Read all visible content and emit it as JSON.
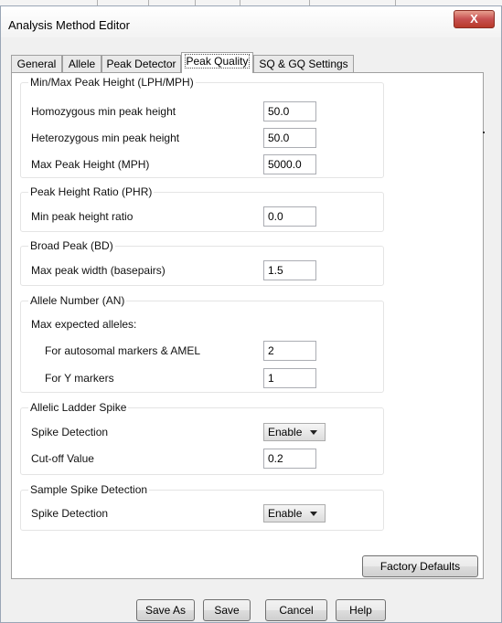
{
  "window": {
    "title": "Analysis Method Editor",
    "close_glyph": "X"
  },
  "tabs": [
    "General",
    "Allele",
    "Peak Detector",
    "Peak Quality",
    "SQ & GQ Settings"
  ],
  "active_tab": "Peak Quality",
  "groups": {
    "lph": {
      "title": "Min/Max Peak Height (LPH/MPH)",
      "homozygous_label": "Homozygous min peak height",
      "homozygous_value": "50.0",
      "heterozygous_label": "Heterozygous min peak height",
      "heterozygous_value": "50.0",
      "max_label": "Max Peak Height (MPH)",
      "max_value": "5000.0"
    },
    "phr": {
      "title": "Peak Height Ratio (PHR)",
      "ratio_label": "Min peak height ratio",
      "ratio_value": "0.0"
    },
    "bd": {
      "title": "Broad Peak (BD)",
      "width_label": "Max peak width (basepairs)",
      "width_value": "1.5"
    },
    "an": {
      "title": "Allele Number (AN)",
      "max_label": "Max expected alleles:",
      "autosomal_label": "For autosomal markers & AMEL",
      "autosomal_value": "2",
      "y_label": "For Y markers",
      "y_value": "1"
    },
    "spike": {
      "title": "Allelic Ladder Spike",
      "detection_label": "Spike Detection",
      "detection_value": "Enable",
      "cutoff_label": "Cut-off Value",
      "cutoff_value": "0.2"
    },
    "sample_spike": {
      "title": "Sample Spike Detection",
      "detection_label": "Spike Detection",
      "detection_value": "Enable"
    }
  },
  "buttons": {
    "factory_defaults": "Factory Defaults",
    "save_as": "Save As",
    "save": "Save",
    "cancel": "Cancel",
    "help": "Help"
  }
}
